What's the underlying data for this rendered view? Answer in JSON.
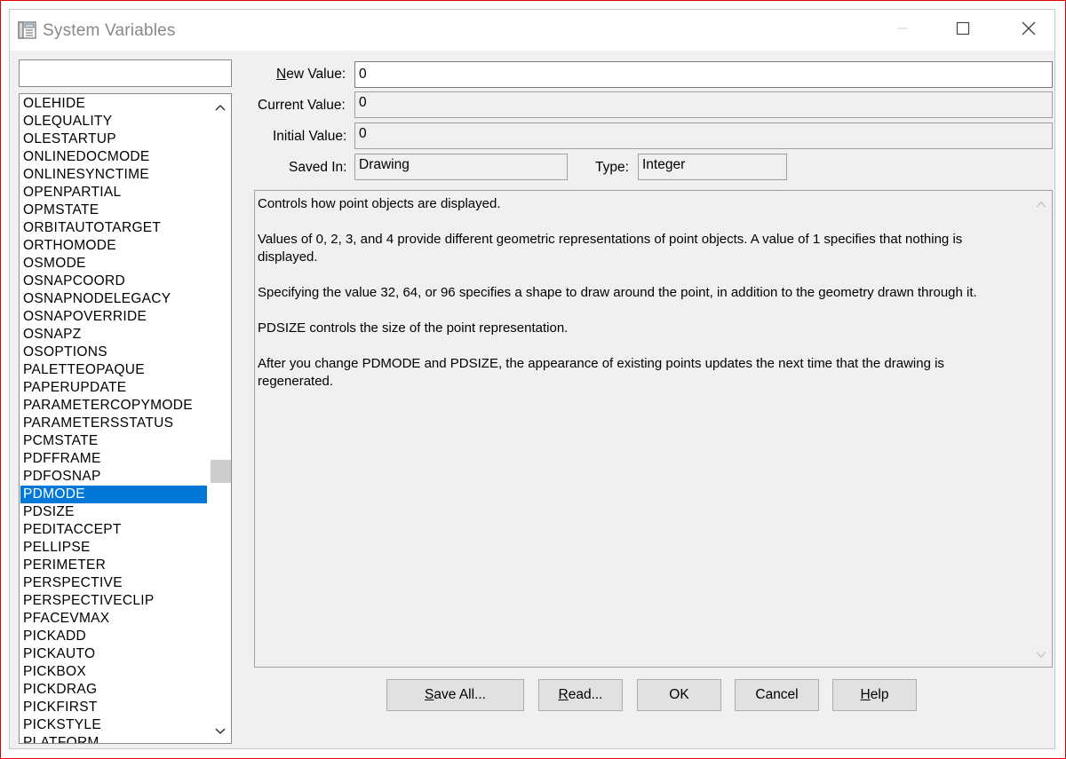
{
  "window": {
    "title": "System Variables"
  },
  "filter": {
    "value": ""
  },
  "list": {
    "selected_index": 22,
    "items": [
      "OLEHIDE",
      "OLEQUALITY",
      "OLESTARTUP",
      "ONLINEDOCMODE",
      "ONLINESYNCTIME",
      "OPENPARTIAL",
      "OPMSTATE",
      "ORBITAUTOTARGET",
      "ORTHOMODE",
      "OSMODE",
      "OSNAPCOORD",
      "OSNAPNODELEGACY",
      "OSNAPOVERRIDE",
      "OSNAPZ",
      "OSOPTIONS",
      "PALETTEOPAQUE",
      "PAPERUPDATE",
      "PARAMETERCOPYMODE",
      "PARAMETERSSTATUS",
      "PCMSTATE",
      "PDFFRAME",
      "PDFOSNAP",
      "PDMODE",
      "PDSIZE",
      "PEDITACCEPT",
      "PELLIPSE",
      "PERIMETER",
      "PERSPECTIVE",
      "PERSPECTIVECLIP",
      "PFACEVMAX",
      "PICKADD",
      "PICKAUTO",
      "PICKBOX",
      "PICKDRAG",
      "PICKFIRST",
      "PICKSTYLE",
      "PLATFORM"
    ]
  },
  "fields": {
    "new_value": {
      "label_ul": "N",
      "label_rest": "ew Value:",
      "value": "0"
    },
    "current_value": {
      "label": "Current Value:",
      "value": "0"
    },
    "initial_value": {
      "label": "Initial Value:",
      "value": "0"
    },
    "saved_in": {
      "label": "Saved In:",
      "value": "Drawing"
    },
    "type": {
      "label": "Type:",
      "value": "Integer"
    }
  },
  "description": {
    "p1": "Controls how point objects are displayed.",
    "p2": "Values of 0, 2, 3, and 4 provide different geometric representations of point objects. A value of 1 specifies that nothing is displayed.",
    "p3": "Specifying the value 32, 64, or 96 specifies a shape to draw around the point, in addition to the geometry drawn through it.",
    "p4": "PDSIZE controls the size of the point representation.",
    "p5": "After you change PDMODE and PDSIZE, the appearance of existing points updates the next time that the drawing is regenerated."
  },
  "buttons": {
    "save_all": {
      "ul": "S",
      "rest": "ave All..."
    },
    "read": {
      "ul": "R",
      "rest": "ead..."
    },
    "ok": {
      "label": "OK"
    },
    "cancel": {
      "label": "Cancel"
    },
    "help": {
      "ul": "H",
      "rest": "elp"
    }
  },
  "icons": {
    "app": "system-variables-icon",
    "minimize": "minimize-icon",
    "maximize": "maximize-icon",
    "close": "close-icon",
    "scroll_up": "chevron-up-icon",
    "scroll_down": "chevron-down-icon"
  },
  "colors": {
    "selection": "#0078d7",
    "window_bg": "#f0f0f0"
  }
}
